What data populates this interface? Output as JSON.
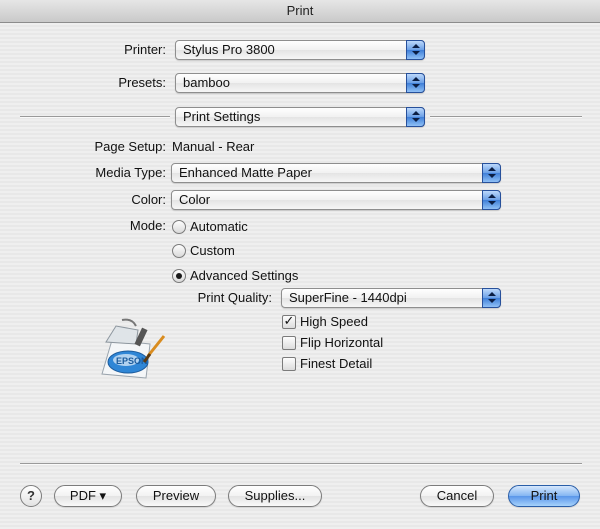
{
  "window": {
    "title": "Print"
  },
  "printer": {
    "label": "Printer:",
    "value": "Stylus Pro 3800"
  },
  "presets": {
    "label": "Presets:",
    "value": "bamboo"
  },
  "panel": {
    "value": "Print Settings"
  },
  "page_setup": {
    "label": "Page Setup:",
    "value": "Manual - Rear"
  },
  "media_type": {
    "label": "Media Type:",
    "value": "Enhanced Matte Paper"
  },
  "color": {
    "label": "Color:",
    "value": "Color"
  },
  "mode": {
    "label": "Mode:",
    "options": [
      "Automatic",
      "Custom",
      "Advanced Settings"
    ],
    "selected": "Advanced Settings"
  },
  "print_quality": {
    "label": "Print Quality:",
    "value": "SuperFine - 1440dpi"
  },
  "checkboxes": [
    {
      "label": "High Speed",
      "checked": true
    },
    {
      "label": "Flip Horizontal",
      "checked": false
    },
    {
      "label": "Finest Detail",
      "checked": false
    }
  ],
  "logo": {
    "text": "EPSON"
  },
  "buttons": {
    "help": "?",
    "pdf": "PDF ▾",
    "preview": "Preview",
    "supplies": "Supplies...",
    "cancel": "Cancel",
    "print": "Print"
  },
  "colors": {
    "accent": "#5a96ea",
    "window_bg": "#ececec"
  }
}
